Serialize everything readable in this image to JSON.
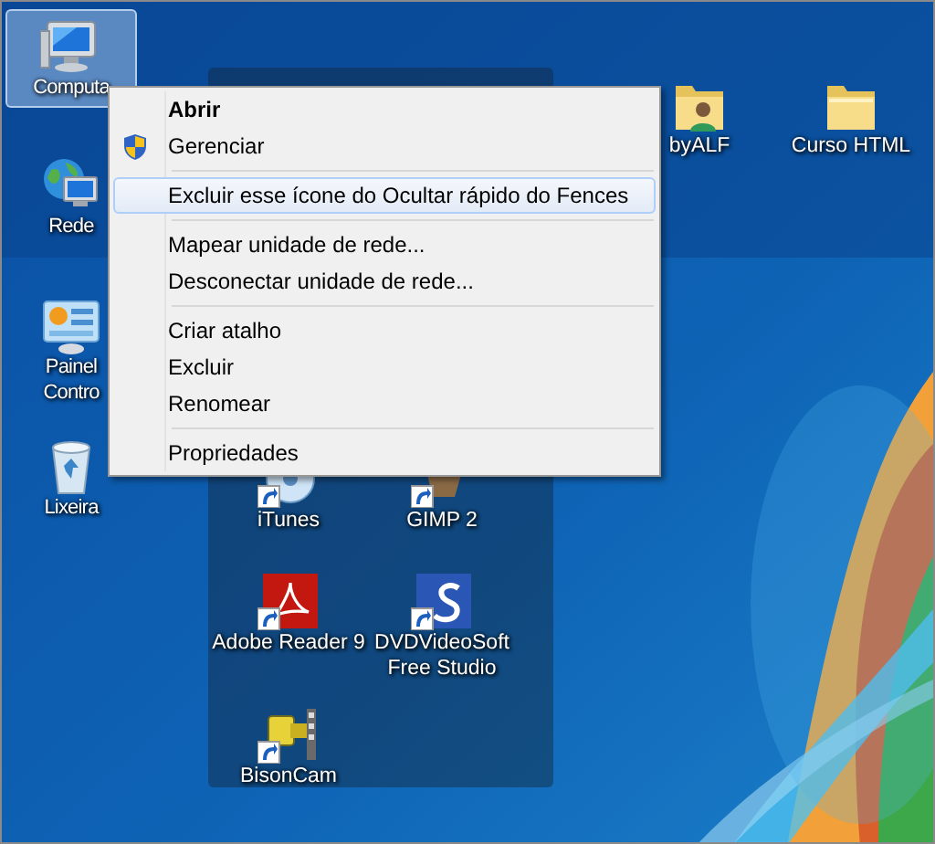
{
  "desktop_icons": [
    {
      "lines": [
        "Computa"
      ],
      "selected": true
    },
    {
      "lines": [
        "Rede"
      ],
      "selected": false
    },
    {
      "lines": [
        "Painel",
        "Contro"
      ],
      "selected": false
    },
    {
      "lines": [
        "Lixeira"
      ],
      "selected": false
    },
    {
      "lines": [
        "byALF"
      ],
      "selected": false
    },
    {
      "lines": [
        "Curso HTML"
      ],
      "selected": false
    }
  ],
  "fence_icons": [
    {
      "lines": [
        "iTunes"
      ]
    },
    {
      "lines": [
        "GIMP 2"
      ]
    },
    {
      "lines": [
        "Adobe Reader 9"
      ]
    },
    {
      "lines": [
        "DVDVideoSoft",
        "Free Studio"
      ]
    },
    {
      "lines": [
        "BisonCam"
      ]
    }
  ],
  "context_menu": [
    {
      "kind": "item",
      "label": "Abrir",
      "default": true,
      "selected": false
    },
    {
      "kind": "shield",
      "label": "Gerenciar",
      "default": false,
      "selected": false
    },
    {
      "kind": "separator"
    },
    {
      "kind": "item",
      "label": "Excluir esse ícone do Ocultar rápido do Fences",
      "default": false,
      "selected": true
    },
    {
      "kind": "separator"
    },
    {
      "kind": "item",
      "label": "Mapear unidade de rede...",
      "default": false,
      "selected": false
    },
    {
      "kind": "item",
      "label": "Desconectar unidade de rede...",
      "default": false,
      "selected": false
    },
    {
      "kind": "separator"
    },
    {
      "kind": "item",
      "label": "Criar atalho",
      "default": false,
      "selected": false
    },
    {
      "kind": "item",
      "label": "Excluir",
      "default": false,
      "selected": false
    },
    {
      "kind": "item",
      "label": "Renomear",
      "default": false,
      "selected": false
    },
    {
      "kind": "separator"
    },
    {
      "kind": "item",
      "label": "Propriedades",
      "default": false,
      "selected": false
    }
  ]
}
